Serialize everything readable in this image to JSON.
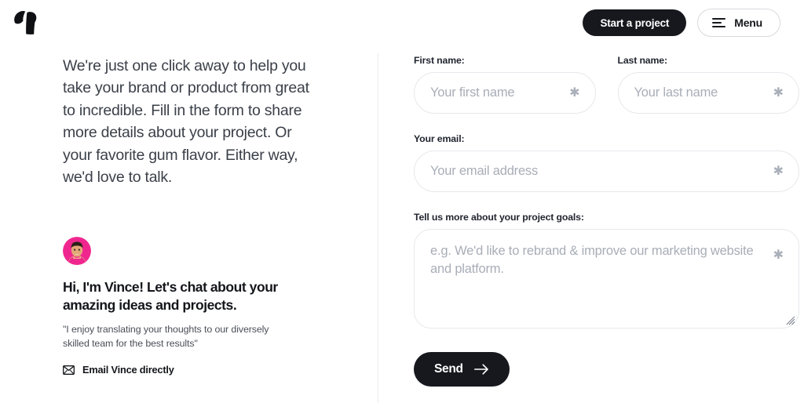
{
  "header": {
    "logo_name": "brand-logo",
    "start_project_label": "Start a project",
    "menu_label": "Menu"
  },
  "left": {
    "intro_paragraph": "We're just one click away to help you take your brand or product from great to incredible. Fill in the form to share more details about your project. Or your favorite gum flavor. Either way, we'd love to talk.",
    "avatar_name": "vince-avatar",
    "avatar_bg_color": "#f0268f",
    "person_heading": "Hi, I'm Vince! Let's chat about your amazing ideas and projects.",
    "person_quote": "\"I enjoy translating your thoughts to our diversely skilled team for the best results\"",
    "email_link_label": "Email Vince directly",
    "email_icon_name": "envelope-icon"
  },
  "form": {
    "first_name": {
      "label": "First name:",
      "placeholder": "Your first name",
      "value": "",
      "required_marker": "✱"
    },
    "last_name": {
      "label": "Last name:",
      "placeholder": "Your last name",
      "value": "",
      "required_marker": "✱"
    },
    "email": {
      "label": "Your email:",
      "placeholder": "Your email address",
      "value": "",
      "required_marker": "✱"
    },
    "goals": {
      "label": "Tell us more about your project goals:",
      "placeholder": "e.g. We'd like to rebrand & improve our marketing website and platform.",
      "value": "",
      "required_marker": "✱"
    },
    "submit_label": "Send",
    "submit_icon_name": "arrow-right-icon"
  },
  "colors": {
    "dark": "#16181d",
    "border": "#e7e8ec",
    "placeholder": "#a8adb7",
    "divider": "#ececee",
    "accent_pink": "#f0268f"
  }
}
